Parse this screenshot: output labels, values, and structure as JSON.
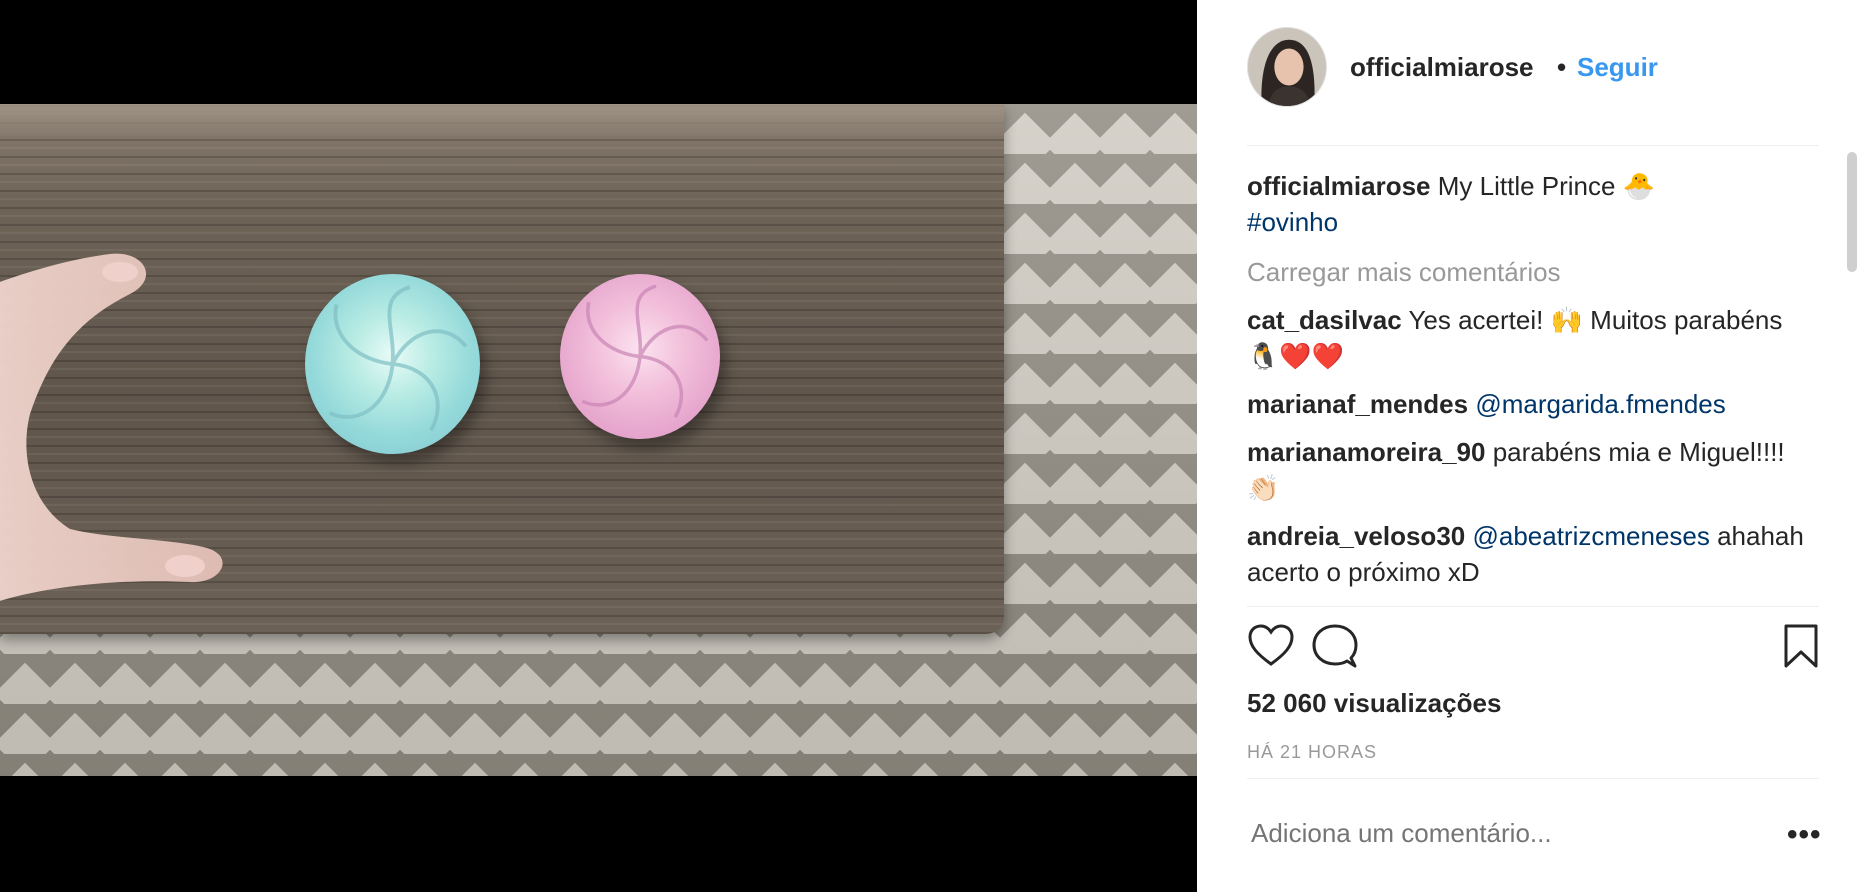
{
  "post": {
    "username": "officialmiarose",
    "separator": "•",
    "follow_label": "Seguir",
    "caption_text": "My Little Prince 🐣",
    "caption_hashtag": "#ovinho",
    "load_more": "Carregar mais comentários",
    "views": "52 060 visualizações",
    "time_ago": "HÁ 21 HORAS",
    "add_comment_placeholder": "Adiciona um comentário...",
    "more_label": "•••"
  },
  "comments": [
    {
      "user": "cat_dasilvac",
      "mention": "",
      "text": "Yes acertei! 🙌 Muitos parabéns 🐧❤️❤️"
    },
    {
      "user": "marianaf_mendes",
      "mention": "@margarida.fmendes",
      "text": ""
    },
    {
      "user": "marianamoreira_90",
      "mention": "",
      "text": "parabéns mia e Miguel!!!! 👏🏻"
    },
    {
      "user": "andreia_veloso30",
      "mention": "@abeatrizcmeneses",
      "text": "ahahah acerto o próximo xD"
    }
  ],
  "icons": {
    "like": "heart-icon",
    "comment": "comment-icon",
    "save": "bookmark-icon"
  },
  "colors": {
    "link_blue": "#3897f0",
    "mention_blue": "#003569",
    "text_dark": "#262626",
    "text_muted": "#999999"
  }
}
